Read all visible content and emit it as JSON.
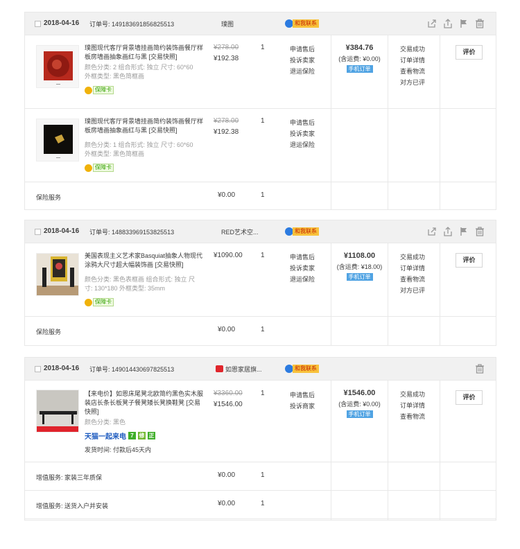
{
  "orders": [
    {
      "date": "2018-04-16",
      "order_no": "订单号: 149183691856825513",
      "shop": "璞图",
      "contact_label": "和我联系",
      "items": [
        {
          "title": "璞图现代客厅背景墙挂画简约装饰画餐厅样板房墙画抽象画红与黑 [交易快照]",
          "attrs": "颜色分类: 2  组合形式: 独立  尺寸: 60*60  外框类型: 黑色简框画",
          "badge": "保障卡",
          "price_orig": "¥278.00",
          "price": "¥192.38",
          "qty": "1",
          "ops": [
            "申请售后",
            "投诉卖家",
            "退运保险"
          ],
          "thumb": "red-art"
        },
        {
          "title": "璞图现代客厅背景墙挂画简约装饰画餐厅样板房墙画抽象画红与黑 [交易快照]",
          "attrs": "颜色分类: 1  组合形式: 独立  尺寸: 60*60  外框类型: 黑色简框画",
          "badge": "保障卡",
          "price_orig": "¥278.00",
          "price": "¥192.38",
          "qty": "1",
          "ops": [
            "申请售后",
            "投诉卖家",
            "退运保险"
          ],
          "thumb": "black-art"
        }
      ],
      "services": [
        {
          "label": "保险服务",
          "price": "¥0.00",
          "qty": "1"
        }
      ],
      "total": "¥384.76",
      "shipping": "(含运费: ¥0.00)",
      "mobile_tag": "手机订单",
      "status": [
        "交易成功",
        "订单详情",
        "查看物流",
        "对方已评"
      ],
      "action": "评价"
    },
    {
      "date": "2018-04-16",
      "order_no": "订单号: 148833969153825513",
      "shop": "RED艺术空...",
      "contact_label": "和我联系",
      "items": [
        {
          "title": "美国表现主义艺术家Basquiat抽象人物现代涂鸦大尺寸超大幅装饰画 [交易快照]",
          "attrs": "颜色分类: 黑色表框画  组合形式: 独立  尺寸: 130*180  外框类型: 35mm",
          "badge": "保障卡",
          "price": "¥1090.00",
          "qty": "1",
          "ops": [
            "申请售后",
            "投诉卖家",
            "退运保险"
          ],
          "thumb": "gallery"
        }
      ],
      "services": [
        {
          "label": "保险服务",
          "price": "¥0.00",
          "qty": "1"
        }
      ],
      "total": "¥1108.00",
      "shipping": "(含运费: ¥18.00)",
      "mobile_tag": "手机订单",
      "status": [
        "交易成功",
        "订单详情",
        "查看物流",
        "对方已评"
      ],
      "action": "评价"
    },
    {
      "date": "2018-04-16",
      "order_no": "订单号: 149014430697825513",
      "shop": "如恩家居旗...",
      "contact_label": "和我联系",
      "items": [
        {
          "title": "【来电价】如恩床尾凳北欧简约黑色实木服装店长条长板凳子餐凳矮长凳换鞋凳 [交易快照]",
          "attrs": "颜色分类: 黑色",
          "tmall": "天猫一起来电",
          "tm_badges": [
            "7",
            "修",
            "正"
          ],
          "ship_time": "发货时间: 付款后45天内",
          "price_orig": "¥3360.00",
          "price": "¥1546.00",
          "qty": "1",
          "ops": [
            "申请售后",
            "投诉商家"
          ],
          "thumb": "bench"
        }
      ],
      "services": [
        {
          "label": "增值服务: 家装三年质保",
          "price": "¥0.00",
          "qty": "1"
        },
        {
          "label": "增值服务: 送货入户并安装",
          "price": "¥0.00",
          "qty": "1"
        }
      ],
      "total": "¥1546.00",
      "shipping": "(含运费: ¥0.00)",
      "mobile_tag": "手机订单",
      "status": [
        "交易成功",
        "订单详情",
        "查看物流"
      ],
      "action": "评价"
    }
  ]
}
